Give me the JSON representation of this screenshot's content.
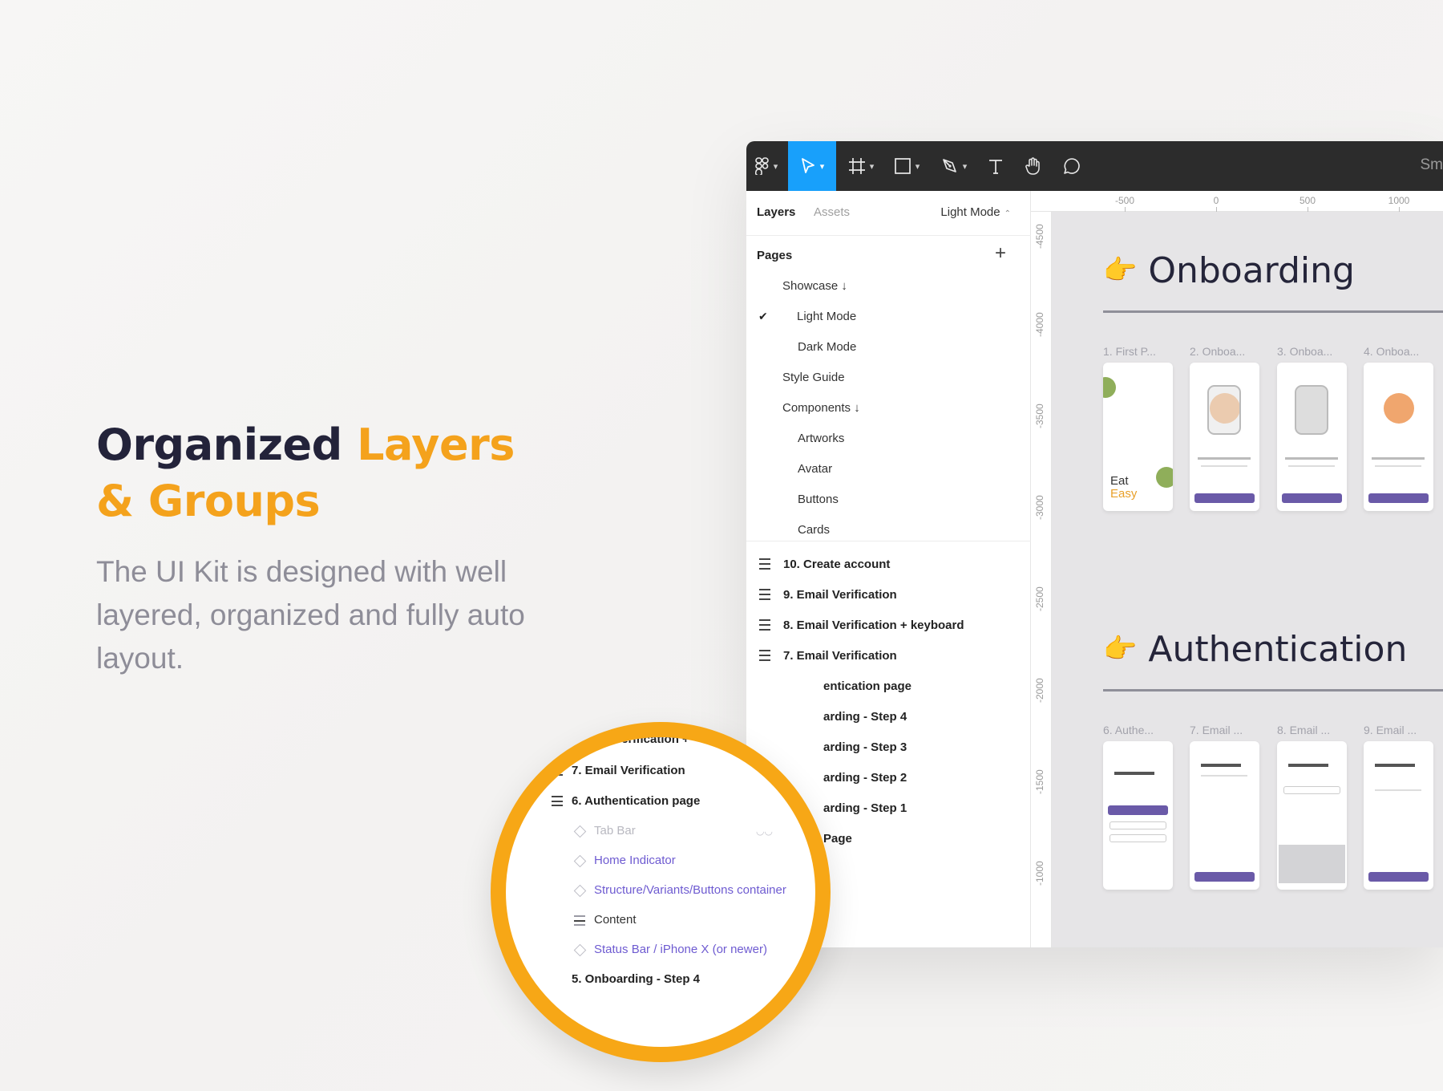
{
  "hero": {
    "title_part1": "Organized ",
    "title_part2": "Layers",
    "title_part3": "& Groups",
    "description": "The UI Kit is designed with well layered, organized and fully auto layout.",
    "accent_color": "#f4a21c"
  },
  "toolbar": {
    "tools": [
      "figma-menu-icon",
      "move-tool-icon",
      "frame-tool-icon",
      "shape-tool-icon",
      "pen-tool-icon",
      "text-tool-icon",
      "hand-tool-icon",
      "comment-tool-icon"
    ],
    "right_label": "Sm",
    "active_color": "#18a0fb"
  },
  "panel": {
    "tab_layers": "Layers",
    "tab_assets": "Assets",
    "current_page": "Light Mode",
    "pages_heading": "Pages",
    "pages": [
      {
        "label": "Showcase ↓"
      },
      {
        "label": "Light Mode"
      },
      {
        "label": "Dark Mode"
      },
      {
        "label": "Style Guide"
      },
      {
        "label": "Components ↓"
      },
      {
        "label": "Artworks"
      },
      {
        "label": "Avatar"
      },
      {
        "label": "Buttons"
      },
      {
        "label": "Cards"
      }
    ],
    "layers": [
      {
        "label": "10. Create account"
      },
      {
        "label": "9. Email Verification"
      },
      {
        "label": "8. Email Verification + keyboard"
      },
      {
        "label": "7. Email Verification"
      },
      {
        "label": "entication page"
      },
      {
        "label": "arding - Step 4"
      },
      {
        "label": "arding - Step 3"
      },
      {
        "label": "arding - Step 2"
      },
      {
        "label": "arding - Step 1"
      },
      {
        "label": "Page"
      }
    ]
  },
  "rulers": {
    "top": [
      "-500",
      "0",
      "500",
      "1000"
    ],
    "left": [
      "-4500",
      "-4000",
      "-3500",
      "-3000",
      "-2500",
      "-2000",
      "-1500",
      "-1000"
    ]
  },
  "canvas": {
    "section1_title": "Onboarding",
    "section1_thumbs": [
      "1. First P...",
      "2. Onboa...",
      "3. Onboa...",
      "4. Onboa..."
    ],
    "thumb1_text1": "Eat",
    "thumb1_text2": "Easy",
    "section2_title": "Authentication",
    "section2_thumbs": [
      "6. Authe...",
      "7. Email ...",
      "8. Email ...",
      "9. Email ..."
    ],
    "hand_emoji": "👉"
  },
  "magnifier": {
    "row0": "Verification +",
    "row1": "7. Email Verification",
    "row2": "6. Authentication page",
    "row3": "Tab Bar",
    "row4": "Home Indicator",
    "row5": "Structure/Variants/Buttons container",
    "row6": "Content",
    "row7": "Status Bar / iPhone X (or newer)",
    "row8": "5. Onboarding - Step 4",
    "plus": "+",
    "border_color": "#f7a716"
  }
}
